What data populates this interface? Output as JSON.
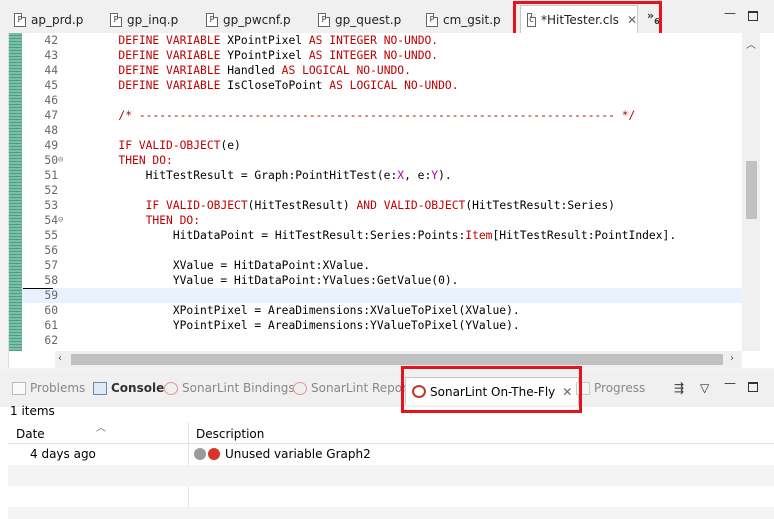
{
  "editor_tabs": [
    {
      "label": "ap_prd.p",
      "icon": "progress-file-icon",
      "active": false
    },
    {
      "label": "gp_inq.p",
      "icon": "progress-file-icon",
      "active": false
    },
    {
      "label": "gp_pwcnf.p",
      "icon": "progress-file-icon",
      "active": false
    },
    {
      "label": "gp_quest.p",
      "icon": "progress-file-icon",
      "active": false
    },
    {
      "label": "cm_gsit.p",
      "icon": "progress-file-icon",
      "active": false
    },
    {
      "label": "*HitTester.cls",
      "icon": "class-file-icon",
      "active": true
    }
  ],
  "overflow_tabs": {
    "label": "»",
    "count": "6"
  },
  "code_lines": [
    {
      "n": "42",
      "fold": "",
      "segs": [
        [
          "        ",
          ""
        ],
        [
          "DEFINE VARIABLE ",
          "kw"
        ],
        [
          "XPointPixel ",
          ""
        ],
        [
          "AS INTEGER NO-UNDO.",
          "kw"
        ]
      ]
    },
    {
      "n": "43",
      "fold": "",
      "segs": [
        [
          "        ",
          ""
        ],
        [
          "DEFINE VARIABLE ",
          "kw"
        ],
        [
          "YPointPixel ",
          ""
        ],
        [
          "AS INTEGER NO-UNDO.",
          "kw"
        ]
      ]
    },
    {
      "n": "44",
      "fold": "",
      "segs": [
        [
          "        ",
          ""
        ],
        [
          "DEFINE VARIABLE ",
          "kw"
        ],
        [
          "Handled ",
          ""
        ],
        [
          "AS LOGICAL NO-UNDO.",
          "kw"
        ]
      ]
    },
    {
      "n": "45",
      "fold": "",
      "segs": [
        [
          "        ",
          ""
        ],
        [
          "DEFINE VARIABLE ",
          "kw"
        ],
        [
          "IsCloseToPoint ",
          ""
        ],
        [
          "AS LOGICAL NO-UNDO.",
          "kw"
        ]
      ]
    },
    {
      "n": "46",
      "fold": "",
      "segs": []
    },
    {
      "n": "47",
      "fold": "",
      "segs": [
        [
          "        ",
          ""
        ],
        [
          "/* ---------------------------------------------------------------------- */",
          "cmt"
        ]
      ]
    },
    {
      "n": "48",
      "fold": "",
      "segs": []
    },
    {
      "n": "49",
      "fold": "",
      "segs": [
        [
          "        ",
          ""
        ],
        [
          "IF VALID-OBJECT",
          "kw"
        ],
        [
          "(e)",
          ""
        ]
      ]
    },
    {
      "n": "50",
      "fold": "⊖",
      "segs": [
        [
          "        ",
          ""
        ],
        [
          "THEN DO:",
          "kw"
        ]
      ]
    },
    {
      "n": "51",
      "fold": "",
      "segs": [
        [
          "            HitTestResult = Graph:PointHitTest(e:",
          ""
        ],
        [
          "X",
          "mem"
        ],
        [
          ", e:",
          ""
        ],
        [
          "Y",
          "mem"
        ],
        [
          ").",
          ""
        ]
      ]
    },
    {
      "n": "52",
      "fold": "",
      "segs": []
    },
    {
      "n": "53",
      "fold": "",
      "segs": [
        [
          "            ",
          ""
        ],
        [
          "IF VALID-OBJECT",
          "kw"
        ],
        [
          "(HitTestResult) ",
          ""
        ],
        [
          "AND VALID-OBJECT",
          "kw"
        ],
        [
          "(HitTestResult:Series)",
          ""
        ]
      ]
    },
    {
      "n": "54",
      "fold": "⊖",
      "segs": [
        [
          "            ",
          ""
        ],
        [
          "THEN DO:",
          "kw"
        ]
      ]
    },
    {
      "n": "55",
      "fold": "",
      "segs": [
        [
          "                HitDataPoint = HitTestResult:Series:Points:",
          ""
        ],
        [
          "Item",
          "kw"
        ],
        [
          "[HitTestResult:PointIndex].",
          ""
        ]
      ]
    },
    {
      "n": "56",
      "fold": "",
      "segs": []
    },
    {
      "n": "57",
      "fold": "",
      "segs": [
        [
          "                XValue = HitDataPoint:XValue.",
          ""
        ]
      ]
    },
    {
      "n": "58",
      "fold": "",
      "segs": [
        [
          "                YValue = HitDataPoint:YValues:GetValue(0).",
          ""
        ]
      ]
    },
    {
      "n": "59",
      "fold": "",
      "segs": [],
      "current": true
    },
    {
      "n": "60",
      "fold": "",
      "segs": [
        [
          "                XPointPixel = AreaDimensions:XValueToPixel(XValue).",
          ""
        ]
      ]
    },
    {
      "n": "61",
      "fold": "",
      "segs": [
        [
          "                YPointPixel = AreaDimensions:YValueToPixel(YValue).",
          ""
        ]
      ]
    },
    {
      "n": "62",
      "fold": "",
      "segs": []
    }
  ],
  "panel_tabs": [
    {
      "label": "Problems",
      "icon": "problems-icon"
    },
    {
      "label": "Console",
      "icon": "console-icon"
    },
    {
      "label": "SonarLint Bindings",
      "icon": "sonarlint-bindings-icon"
    },
    {
      "label": "SonarLint Report",
      "icon": "sonarlint-report-icon"
    },
    {
      "label": "SonarLint On-The-Fly",
      "icon": "sonarlint-icon"
    },
    {
      "label": "Progress",
      "icon": "progress-icon"
    }
  ],
  "panel_status": "1 items",
  "table": {
    "columns": [
      "Date",
      "Description"
    ],
    "rows": [
      {
        "date": "4 days ago",
        "description": "Unused variable Graph2"
      }
    ]
  },
  "colors": {
    "highlight": "#e8121a",
    "keyword": "#c00000",
    "member": "#b000b0"
  }
}
